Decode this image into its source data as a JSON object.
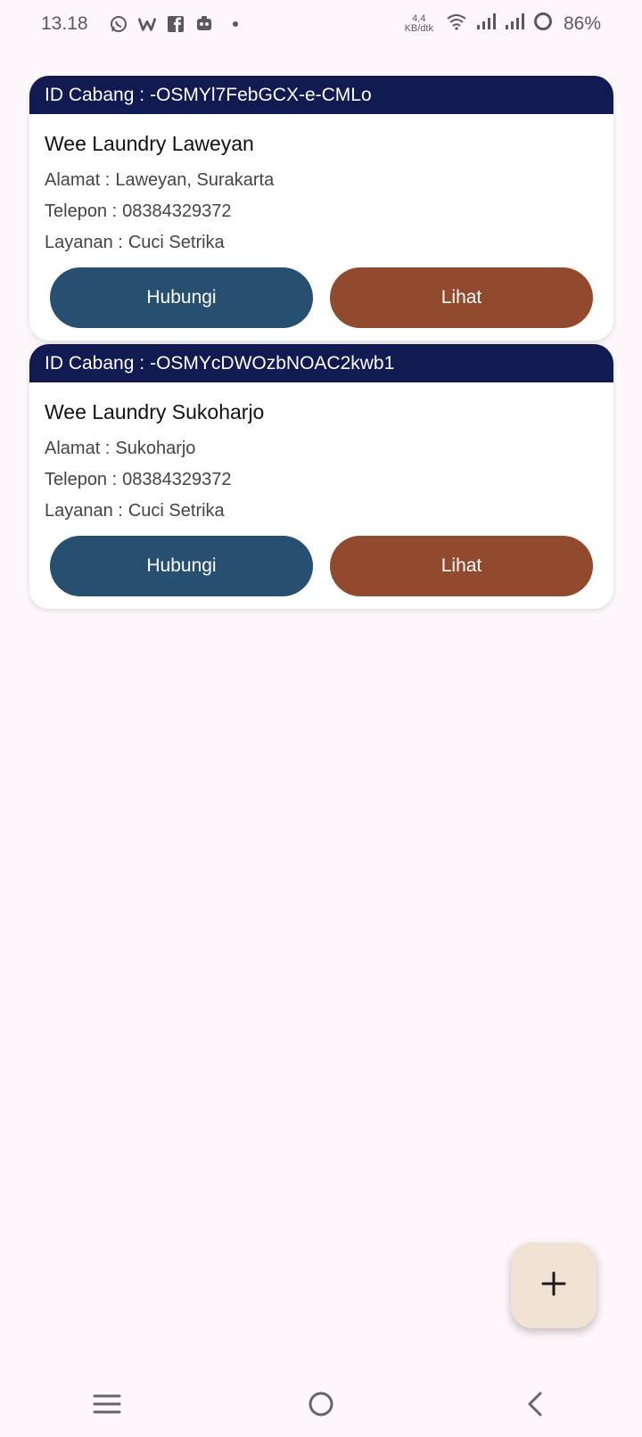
{
  "status_bar": {
    "time": "13.18",
    "net_speed_value": "4,4",
    "net_speed_unit": "KB/dtk",
    "battery": "86%"
  },
  "branches": [
    {
      "id_label": "ID Cabang :",
      "id_value": "-OSMYl7FebGCX-e-CMLo",
      "name": "Wee Laundry Laweyan",
      "address_label": "Alamat :",
      "address": "Laweyan, Surakarta",
      "phone_label": "Telepon :",
      "phone": "08384329372",
      "service_label": "Layanan :",
      "service": "Cuci Setrika",
      "contact_button": "Hubungi",
      "view_button": "Lihat"
    },
    {
      "id_label": "ID Cabang :",
      "id_value": "-OSMYcDWOzbNOAC2kwb1",
      "name": "Wee Laundry Sukoharjo",
      "address_label": "Alamat :",
      "address": "Sukoharjo",
      "phone_label": "Telepon :",
      "phone": "08384329372",
      "service_label": "Layanan :",
      "service": "Cuci Setrika",
      "contact_button": "Hubungi",
      "view_button": "Lihat"
    }
  ],
  "fab": {
    "icon": "plus-icon"
  },
  "colors": {
    "header": "#121a52",
    "contact_button": "#264f70",
    "view_button": "#924a2e",
    "fab": "#f1e3d3",
    "background": "#fdf7fc"
  }
}
